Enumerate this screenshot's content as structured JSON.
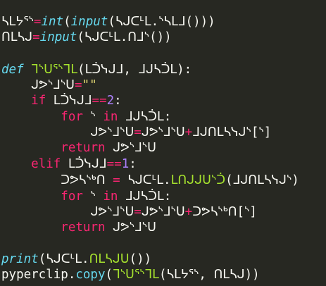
{
  "code": {
    "l1": {
      "var": "ᓴᒪᔭᕐᔅ",
      "eq": "=",
      "int_kw": "int",
      "p1": "(",
      "input_kw": "input",
      "p2": "(",
      "arg": "ᓴᒍᑕᒻᒪ.ᔅᓴᒪᒧ",
      "end": "()))"
    },
    "l2": {
      "var": "ᑎᒪᓴᒍ",
      "eq": "=",
      "input_kw": "input",
      "p1": "(",
      "arg": "ᓴᒍᑕᒻᒪ.ᑎᒧᔅ",
      "end": "())"
    },
    "l4": {
      "def_kw": "def",
      "fname": "ᒣᔅᑌᕐᔅᒣᒪ",
      "params": "(ᒪᑑᓭᒍᒧ, ᒧᒍᓴᑑᒪ):"
    },
    "l5": {
      "var": "ᒍᕗᔅᒧᔅᑌ",
      "eq": "=",
      "str": "\"\""
    },
    "l6": {
      "kw": "if",
      "var": "ᒪᑑᓭᒍᒧ",
      "op": "==",
      "num": "2",
      "colon": ":"
    },
    "l7": {
      "kw": "for",
      "var": "ᔅ",
      "in_kw": "in",
      "iter": "ᒧᒍᓴᑑᒪ:"
    },
    "l8": {
      "lhs": "ᒍᕗᔅᒧᔅᑌ",
      "eq": "=",
      "rhs": "ᒍᕗᔅᒧᔅᑌ",
      "plus": "+",
      "tail": "ᒧᒍᑎᒪᓴᓭᒍᔅ[ᔅ]"
    },
    "l9": {
      "kw": "return",
      "var": "ᒍᕗᔅᒧᔅᑌ"
    },
    "l10": {
      "kw": "elif",
      "var": "ᒪᑑᓭᒍᒧ",
      "op": "==",
      "num": "1",
      "colon": ":"
    },
    "l11": {
      "var": "ᑐᕗᓴᔅᒃᑎ",
      "eq": "=",
      "obj": "ᓴᒍᑕᒻᒪ.",
      "method": "ᒪᑎᒍᒍᑌᔅᑑ",
      "args": "(ᒧᒍᑎᒪᓴᓭᒍᔅ)"
    },
    "l12": {
      "kw": "for",
      "var": "ᔅ",
      "in_kw": "in",
      "iter": "ᒧᒍᓴᑑᒪ:"
    },
    "l13": {
      "lhs": "ᒍᕗᔅᒧᔅᑌ",
      "eq": "=",
      "rhs": "ᒍᕗᔅᒧᔅᑌ",
      "plus": "+",
      "tail": "ᑐᕗᓴᔅᒃᑎ[ᔅ]"
    },
    "l14": {
      "kw": "return",
      "var": "ᒍᕗᔅᒧᔅᑌ"
    },
    "l16": {
      "fn": "print",
      "p1": "(",
      "obj": "ᓴᒍᑕᒻᒪ.",
      "method": "ᑎᒪᓴᒍᑌ",
      "end": "())"
    },
    "l17": {
      "mod": "pyperclip.",
      "fn": "copy",
      "p1": "(",
      "fname": "ᒣᔅᑌᕐᔅᒣᒪ",
      "args": "(ᓴᒪᔭᕐᔅ, ᑎᒪᓴᒍ))"
    }
  },
  "colors": {
    "background": "#272822",
    "keyword": "#f92672",
    "builtin": "#66d9ef",
    "function": "#a6e22e",
    "number": "#ae81ff",
    "string": "#e6db74",
    "plain": "#f8f8f2"
  }
}
